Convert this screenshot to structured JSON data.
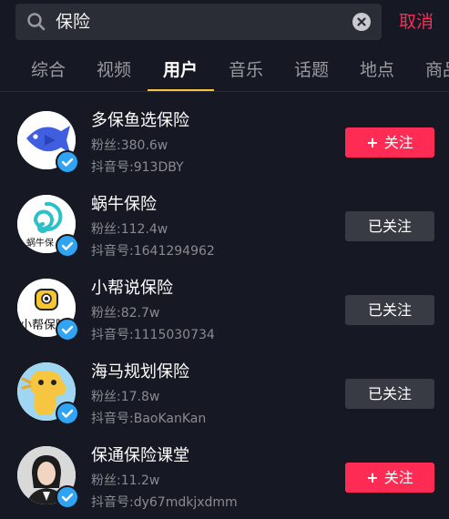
{
  "search": {
    "query": "保险",
    "cancel_label": "取消"
  },
  "tabs": [
    {
      "label": "综合"
    },
    {
      "label": "视频"
    },
    {
      "label": "用户",
      "active": true
    },
    {
      "label": "音乐"
    },
    {
      "label": "话题"
    },
    {
      "label": "地点"
    },
    {
      "label": "商品"
    }
  ],
  "users": [
    {
      "name": "多保鱼选保险",
      "fans": "粉丝:380.6w",
      "id": "抖音号:913DBY",
      "button": "关注",
      "followed": false,
      "avatar_icon": "blue-fish-logo",
      "verified": true
    },
    {
      "name": "蜗牛保险",
      "fans": "粉丝:112.4w",
      "id": "抖音号:1641294962",
      "button": "已关注",
      "followed": true,
      "avatar_icon": "snail-logo",
      "avatar_text": "蜗牛保",
      "verified": true
    },
    {
      "name": "小帮说保险",
      "fans": "粉丝:82.7w",
      "id": "抖音号:1115030734",
      "button": "已关注",
      "followed": true,
      "avatar_icon": "yellow-face-logo",
      "avatar_text": "小帮保险",
      "verified": true
    },
    {
      "name": "海马规划保险",
      "fans": "粉丝:17.8w",
      "id": "抖音号:BaoKanKan",
      "button": "已关注",
      "followed": true,
      "avatar_icon": "seahorse-cartoon",
      "verified": true
    },
    {
      "name": "保通保险课堂",
      "fans": "粉丝:11.2w",
      "id": "抖音号:dy67mdkjxdmm",
      "button": "关注",
      "followed": false,
      "avatar_icon": "woman-portrait",
      "verified": true
    }
  ],
  "colors": {
    "background": "#161823",
    "accent": "#fe2c55",
    "tab_indicator": "#f7c242",
    "verified": "#2fa4f5"
  }
}
